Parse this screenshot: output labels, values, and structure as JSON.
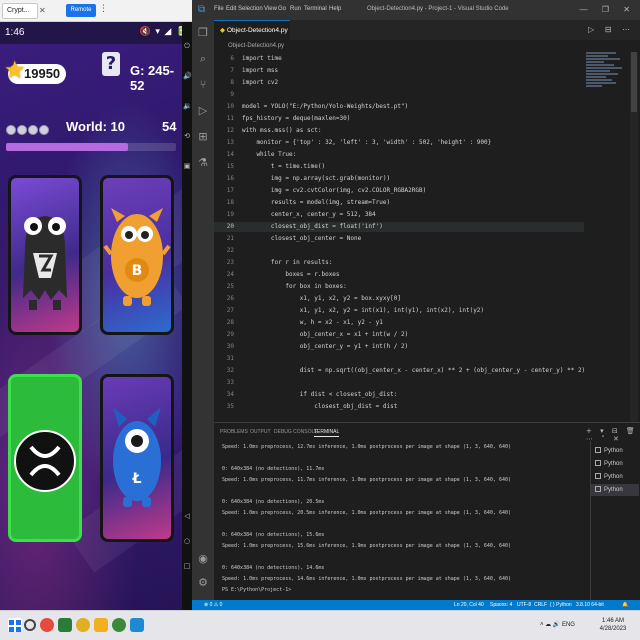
{
  "mirror": {
    "tab_title": "Crypt...",
    "close_glyph": "✕",
    "remote_label": "Remote",
    "menu_glyph": "⋮",
    "status_time": "1:46",
    "status_icons": "🔇 ▾ ◢ 🔋"
  },
  "game": {
    "coins": "19950",
    "help": "?",
    "games_count": "G: 245-52",
    "lives": 4,
    "world": "World: 10",
    "score": "54",
    "progress_fraction": 0.72,
    "cards": [
      {
        "name": "card-monster-white",
        "state": "face-up"
      },
      {
        "name": "card-bitcoin-monster",
        "state": "face-up"
      },
      {
        "name": "card-xrp",
        "state": "matched",
        "color": "#2dbb3c"
      },
      {
        "name": "card-litecoin-monster",
        "state": "face-up"
      }
    ]
  },
  "vscode": {
    "menu": [
      "File",
      "Edit",
      "Selection",
      "View",
      "Go",
      "Run",
      "Terminal",
      "Help"
    ],
    "window_title": "Object-Detection4.py - Project-1 - Visual Studio Code",
    "window_controls": "— ❐ ✕",
    "tab_label": "Object-Detection4.py",
    "tab_actions": "▷ ⊟ ⋯",
    "breadcrumb": "Object-Detection4.py",
    "current_line": 20,
    "code_lines": [
      {
        "n": "6",
        "t": "import time"
      },
      {
        "n": "7",
        "t": "import mss"
      },
      {
        "n": "8",
        "t": "import cv2"
      },
      {
        "n": "9",
        "t": ""
      },
      {
        "n": "10",
        "t": "model = YOLO(\"E:/Python/Yolo-Weights/best.pt\")"
      },
      {
        "n": "11",
        "t": "fps_history = deque(maxlen=30)"
      },
      {
        "n": "12",
        "t": "with mss.mss() as sct:"
      },
      {
        "n": "13",
        "t": "    monitor = {'top' : 32, 'left' : 3, 'width' : 502, 'height' : 900}"
      },
      {
        "n": "14",
        "t": "    while True:"
      },
      {
        "n": "15",
        "t": "        t = time.time()"
      },
      {
        "n": "16",
        "t": "        img = np.array(sct.grab(monitor))"
      },
      {
        "n": "17",
        "t": "        img = cv2.cvtColor(img, cv2.COLOR_RGBA2RGB)"
      },
      {
        "n": "18",
        "t": "        results = model(img, stream=True)"
      },
      {
        "n": "19",
        "t": "        center_x, center_y = 512, 384"
      },
      {
        "n": "20",
        "t": "        closest_obj_dist = float('inf')"
      },
      {
        "n": "21",
        "t": "        closest_obj_center = None"
      },
      {
        "n": "22",
        "t": ""
      },
      {
        "n": "23",
        "t": "        for r in results:"
      },
      {
        "n": "24",
        "t": "            boxes = r.boxes"
      },
      {
        "n": "25",
        "t": "            for box in boxes:"
      },
      {
        "n": "26",
        "t": "                x1, y1, x2, y2 = box.xyxy[0]"
      },
      {
        "n": "27",
        "t": "                x1, y1, x2, y2 = int(x1), int(y1), int(x2), int(y2)"
      },
      {
        "n": "28",
        "t": "                w, h = x2 - x1, y2 - y1"
      },
      {
        "n": "29",
        "t": "                obj_center_x = x1 + int(w / 2)"
      },
      {
        "n": "30",
        "t": "                obj_center_y = y1 + int(h / 2)"
      },
      {
        "n": "31",
        "t": ""
      },
      {
        "n": "32",
        "t": "                dist = np.sqrt((obj_center_x - center_x) ** 2 + (obj_center_y - center_y) ** 2)"
      },
      {
        "n": "33",
        "t": ""
      },
      {
        "n": "34",
        "t": "                if dist < closest_obj_dist:"
      },
      {
        "n": "35",
        "t": "                    closest_obj_dist = dist"
      }
    ],
    "panel_tabs": [
      "PROBLEMS",
      "OUTPUT",
      "DEBUG CONSOLE",
      "TERMINAL"
    ],
    "panel_active": "TERMINAL",
    "panel_actions": "+ ▾ ⊟ 🗑 ⋯ ˄ ✕",
    "terminal_lines": [
      "Speed: 1.0ms preprocess, 12.7ms inference, 1.0ms postprocess per image at shape (1, 3, 640, 640)",
      "",
      "0: 640x384 (no detections), 11.7ms",
      "Speed: 1.0ms preprocess, 11.7ms inference, 1.0ms postprocess per image at shape (1, 3, 640, 640)",
      "",
      "0: 640x384 (no detections), 20.5ms",
      "Speed: 1.0ms preprocess, 20.5ms inference, 1.0ms postprocess per image at shape (1, 3, 640, 640)",
      "",
      "0: 640x384 (no detections), 15.6ms",
      "Speed: 1.0ms preprocess, 15.6ms inference, 1.9ms postprocess per image at shape (1, 3, 640, 640)",
      "",
      "0: 640x384 (no detections), 14.6ms",
      "Speed: 1.0ms preprocess, 14.6ms inference, 1.0ms postprocess per image at shape (1, 3, 640, 640)",
      "PS E:\\Python\\Project-1>"
    ],
    "terminal_list": [
      "Python",
      "Python",
      "Python",
      "Python"
    ],
    "statusbar_left": "⊗ 0 ⚠ 0",
    "statusbar_right": [
      "Ln 20, Col 40",
      "Spaces: 4",
      "UTF-8",
      "CRLF",
      "{ } Python",
      "3.8.10 64-bit",
      "🔔"
    ],
    "accent": "#007acc"
  },
  "taskbar": {
    "tray": "˄ ☁ 🔊 ENG",
    "time": "1:46 AM",
    "date": "4/28/2023"
  }
}
